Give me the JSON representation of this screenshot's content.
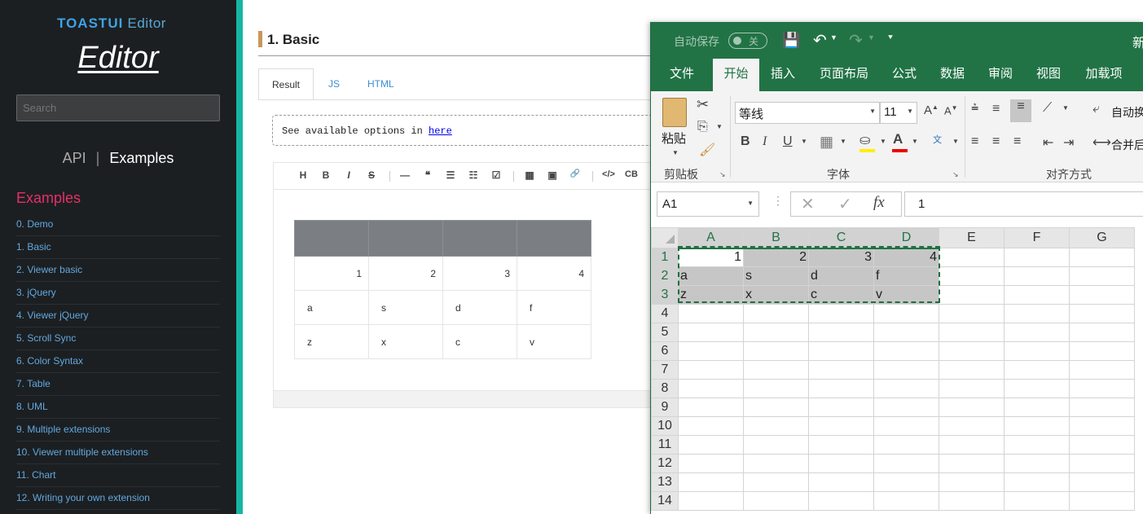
{
  "sidebar": {
    "logo_brand": "TOAST",
    "logo_ui": "UI",
    "logo_product": "Editor",
    "logo_big": "Editor",
    "search_placeholder": "Search",
    "nav_api": "API",
    "nav_sep": "|",
    "nav_examples": "Examples",
    "section_title": "Examples",
    "items": [
      "0. Demo",
      "1. Basic",
      "2. Viewer basic",
      "3. jQuery",
      "4. Viewer jQuery",
      "5. Scroll Sync",
      "6. Color Syntax",
      "7. Table",
      "8. UML",
      "9. Multiple extensions",
      "10. Viewer multiple extensions",
      "11. Chart",
      "12. Writing your own extension"
    ]
  },
  "main": {
    "title": "1. Basic",
    "tabs": [
      "Result",
      "JS",
      "HTML"
    ],
    "notice_text": "See available options in ",
    "notice_link": "here",
    "toolbar": [
      "H",
      "B",
      "I",
      "S",
      "—",
      "❝",
      "☰",
      "☷",
      "☑",
      "▦",
      "▣",
      "🔗",
      "</>",
      "CB"
    ],
    "table": {
      "rows": [
        [
          "1",
          "2",
          "3",
          "4"
        ],
        [
          "a",
          "s",
          "d",
          "f"
        ],
        [
          "z",
          "x",
          "c",
          "v"
        ]
      ]
    }
  },
  "excel": {
    "autosave_label": "自动保存",
    "autosave_state": "关",
    "title_fragment": "新",
    "ribbon_tabs": [
      "文件",
      "开始",
      "插入",
      "页面布局",
      "公式",
      "数据",
      "审阅",
      "视图",
      "加载项"
    ],
    "paste_label": "粘贴",
    "clipboard_label": "剪贴板",
    "font_label": "字体",
    "align_label": "对齐方式",
    "font_name": "等线",
    "font_size": "11",
    "wrap_label": "自动换",
    "merge_label": "合并后",
    "name_box": "A1",
    "formula_value": "1",
    "columns": [
      "A",
      "B",
      "C",
      "D",
      "E",
      "F",
      "G"
    ],
    "row_numbers": [
      "1",
      "2",
      "3",
      "4",
      "5",
      "6",
      "7",
      "8",
      "9",
      "10",
      "11",
      "12",
      "13",
      "14"
    ],
    "cells": [
      [
        "1",
        "2",
        "3",
        "4"
      ],
      [
        "a",
        "s",
        "d",
        "f"
      ],
      [
        "z",
        "x",
        "c",
        "v"
      ]
    ]
  }
}
